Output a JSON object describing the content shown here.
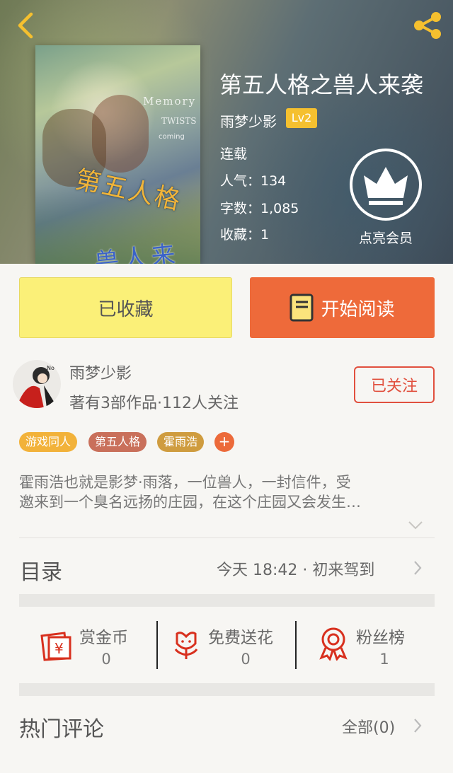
{
  "book": {
    "title": "第五人格之兽人来袭",
    "author": "雨梦少影",
    "level": "Lv2",
    "status": "连载",
    "popularity": "人气：134",
    "word_count": "字数：1,085",
    "collections": "收藏：1",
    "member_label": "点亮会员"
  },
  "cover": {
    "line1": "Memory",
    "line2": "TWISTS",
    "line3": "coming",
    "title_top": "第五人格",
    "title_bottom": "兽人来袭"
  },
  "actions": {
    "favorited_label": "已收藏",
    "read_label": "开始阅读"
  },
  "author_row": {
    "name": "雨梦少影",
    "subtitle": "著有3部作品·112人关注",
    "follow_label": "已关注"
  },
  "tags": [
    "游戏同人",
    "第五人格",
    "霍雨浩"
  ],
  "tag_plus": "+",
  "description": {
    "line1": "霍雨浩也就是影梦·雨落，一位兽人，一封信件，受",
    "line2": "邀来到一个臭名远扬的庄园，在这个庄园又会发生…"
  },
  "catalog": {
    "title": "目录",
    "info": "今天 18:42 · 初来驾到"
  },
  "rewards": [
    {
      "label": "赏金币",
      "count": "0",
      "icon": "red-envelope-icon"
    },
    {
      "label": "免费送花",
      "count": "0",
      "icon": "flower-icon"
    },
    {
      "label": "粉丝榜",
      "count": "1",
      "icon": "rosette-icon"
    }
  ],
  "comments": {
    "title": "热门评论",
    "all_label": "全部(0)"
  },
  "colors": {
    "accent_orange": "#ee6a3a",
    "favorite_yellow": "#fbf078",
    "follow_red": "#e1503e",
    "lv_badge": "#f5c02f",
    "tag_colors": [
      "#f2b23a",
      "#c9705b",
      "#cf9c3f"
    ]
  }
}
